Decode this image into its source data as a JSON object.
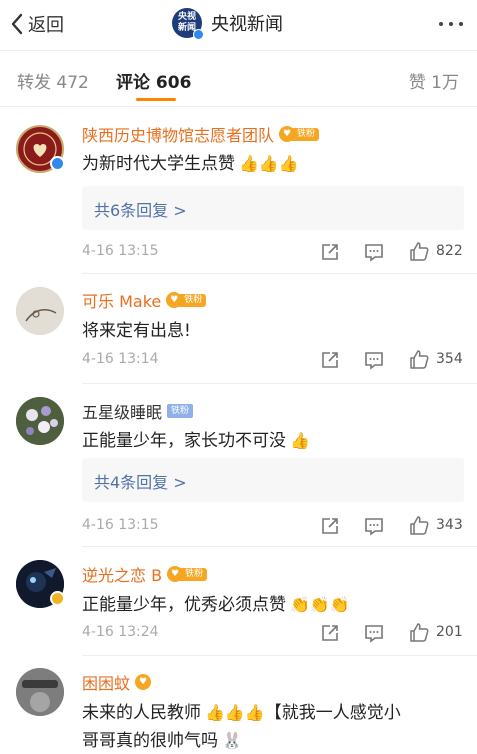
{
  "header": {
    "back_label": "返回",
    "logo_text_1": "央视",
    "logo_text_2": "新闻",
    "title": "央视新闻"
  },
  "tabs": {
    "repost": "转发 472",
    "comment": "评论 606",
    "like": "赞 1万"
  },
  "comments": [
    {
      "name": "陕西历史博物馆志愿者团队",
      "badge": "铁粉",
      "text": "为新时代大学生点赞",
      "reply": "共6条回复 >",
      "time": "4-16 13:15",
      "likes": "822"
    },
    {
      "name": "可乐 Make",
      "badge": "铁粉",
      "text": "将来定有出息!",
      "time": "4-16 13:14",
      "likes": "354"
    },
    {
      "name": "五星级睡眠",
      "badge": "铁粉",
      "text": "正能量少年，家长功不可没",
      "reply": "共4条回复 >",
      "time": "4-16 13:15",
      "likes": "343"
    },
    {
      "name": "逆光之恋 B",
      "badge": "铁粉",
      "text": "正能量少年，优秀必须点赞",
      "time": "4-16 13:24",
      "likes": "201"
    },
    {
      "name": "困困蚊",
      "text_line1": "未来的人民教师",
      "text_line1_tail": "【就我一人感觉小",
      "text_line2": "哥哥真的很帅气吗"
    }
  ],
  "colors": {
    "accent": "#ff8200",
    "name_orange": "#e86f1f",
    "link_blue": "#5272a8"
  }
}
